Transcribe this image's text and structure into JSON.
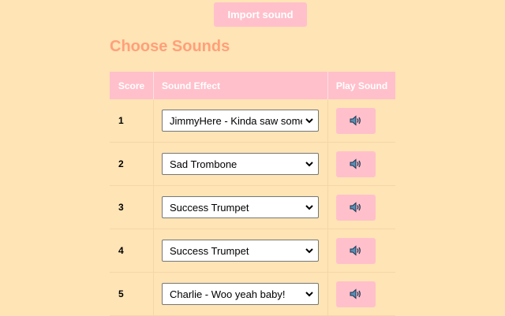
{
  "toolbar": {
    "import_label": "Import sound"
  },
  "page": {
    "title": "Choose Sounds"
  },
  "table": {
    "headers": {
      "score": "Score",
      "effect": "Sound Effect",
      "play": "Play Sound"
    },
    "rows": [
      {
        "score": "1",
        "effect": "JimmyHere - Kinda saw some"
      },
      {
        "score": "2",
        "effect": "Sad Trombone"
      },
      {
        "score": "3",
        "effect": "Success Trumpet"
      },
      {
        "score": "4",
        "effect": "Success Trumpet"
      },
      {
        "score": "5",
        "effect": "Charlie - Woo yeah baby!"
      }
    ]
  },
  "icons": {
    "play": "speaker-icon",
    "dropdown": "chevron-down-icon"
  },
  "colors": {
    "background": "#ffe4b5",
    "accent_pink": "#ffc0cb",
    "title": "#ffa07a"
  }
}
